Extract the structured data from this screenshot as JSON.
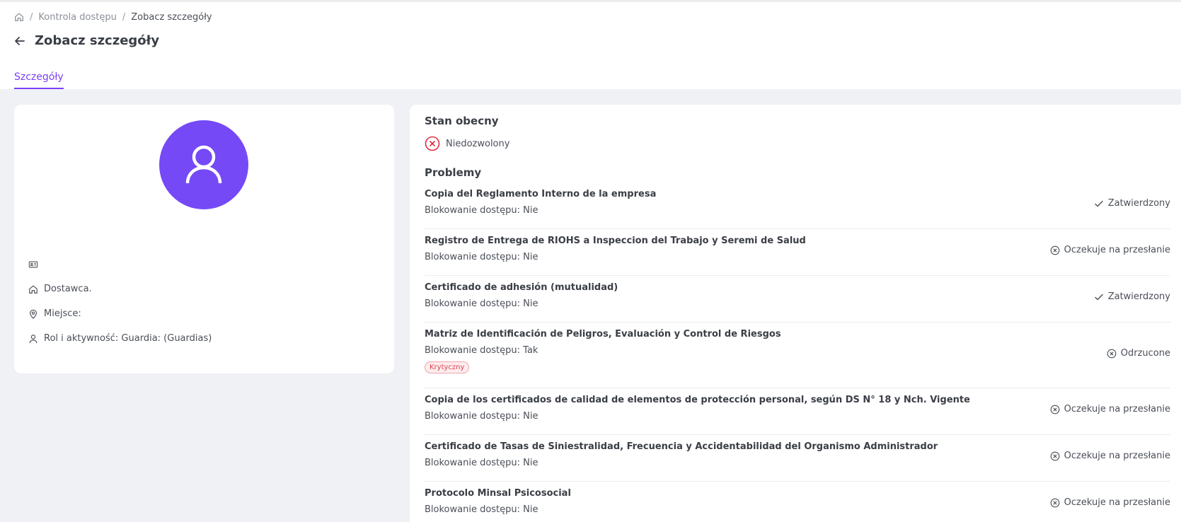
{
  "breadcrumb": {
    "home_icon": "home-icon",
    "items": [
      "Kontrola dostępu",
      "Zobacz szczegóły"
    ]
  },
  "header": {
    "back_icon": "arrow-left-icon",
    "title": "Zobacz szczegóły"
  },
  "tabs": [
    {
      "label": "Szczegóły",
      "active": true
    }
  ],
  "profile": {
    "avatar_icon": "user-icon",
    "avatar_color": "#7549f6",
    "id_value": "",
    "supplier_label": "Dostawca.",
    "place_label": "Miejsce:",
    "role_label": "Rol i aktywność: Guardia: (Guardias)"
  },
  "current_state": {
    "title": "Stan obecny",
    "status": "Niedozwolony",
    "status_icon": "x-circle-icon",
    "status_color": "#e0303f"
  },
  "problems_section": {
    "title": "Problemy",
    "items": [
      {
        "name": "Copia del Reglamento Interno de la empresa",
        "blocking": "Blokowanie dostępu: Nie",
        "badge": "",
        "status": "Zatwierdzony",
        "status_icon": "check-icon"
      },
      {
        "name": "Registro de Entrega de RIOHS a Inspeccion del Trabajo y Seremi de Salud",
        "blocking": "Blokowanie dostępu: Nie",
        "badge": "",
        "status": "Oczekuje na przesłanie",
        "status_icon": "x-circle-icon"
      },
      {
        "name": "Certificado de adhesión (mutualidad)",
        "blocking": "Blokowanie dostępu: Nie",
        "badge": "",
        "status": "Zatwierdzony",
        "status_icon": "check-icon"
      },
      {
        "name": "Matriz de Identificación de Peligros, Evaluación y Control de Riesgos",
        "blocking": "Blokowanie dostępu: Tak",
        "badge": "Krytyczny",
        "status": "Odrzucone",
        "status_icon": "x-circle-icon"
      },
      {
        "name": "Copia de los certificados de calidad de elementos de protección personal, según DS N° 18 y Nch. Vigente",
        "blocking": "Blokowanie dostępu: Nie",
        "badge": "",
        "status": "Oczekuje na przesłanie",
        "status_icon": "x-circle-icon"
      },
      {
        "name": "Certificado de Tasas de Siniestralidad, Frecuencia y Accidentabilidad del Organismo Administrador",
        "blocking": "Blokowanie dostępu: Nie",
        "badge": "",
        "status": "Oczekuje na przesłanie",
        "status_icon": "x-circle-icon"
      },
      {
        "name": "Protocolo Minsal Psicosocial",
        "blocking": "Blokowanie dostępu: Nie",
        "badge": "",
        "status": "Oczekuje na przesłanie",
        "status_icon": "x-circle-icon"
      }
    ]
  },
  "colors": {
    "accent": "#7b42f6",
    "danger": "#e0303f"
  }
}
